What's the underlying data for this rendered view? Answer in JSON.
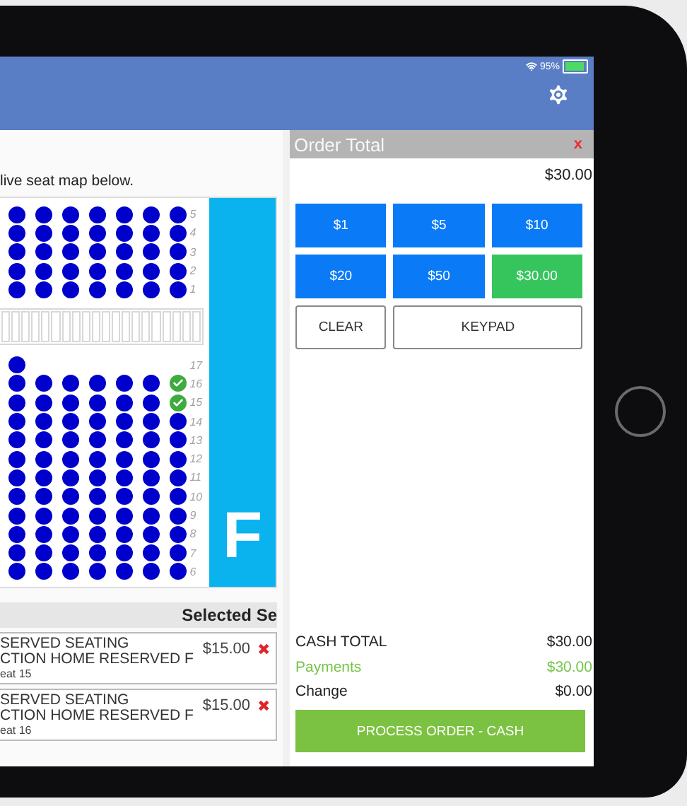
{
  "status_bar": {
    "battery": "95%"
  },
  "intro": "live seat map below.",
  "seat_map": {
    "section_label": "F",
    "upper_rows": [
      {
        "label": "5",
        "seats": [
          {
            "selected": false
          },
          {
            "selected": false
          },
          {
            "selected": false
          },
          {
            "selected": false
          },
          {
            "selected": false
          },
          {
            "selected": false
          },
          {
            "selected": false
          }
        ]
      },
      {
        "label": "4",
        "seats": [
          {
            "selected": false
          },
          {
            "selected": false
          },
          {
            "selected": false
          },
          {
            "selected": false
          },
          {
            "selected": false
          },
          {
            "selected": false
          },
          {
            "selected": false
          }
        ]
      },
      {
        "label": "3",
        "seats": [
          {
            "selected": false
          },
          {
            "selected": false
          },
          {
            "selected": false
          },
          {
            "selected": false
          },
          {
            "selected": false
          },
          {
            "selected": false
          },
          {
            "selected": false
          }
        ]
      },
      {
        "label": "2",
        "seats": [
          {
            "selected": false
          },
          {
            "selected": false
          },
          {
            "selected": false
          },
          {
            "selected": false
          },
          {
            "selected": false
          },
          {
            "selected": false
          },
          {
            "selected": false
          }
        ]
      },
      {
        "label": "1",
        "seats": [
          {
            "selected": false
          },
          {
            "selected": false
          },
          {
            "selected": false
          },
          {
            "selected": false
          },
          {
            "selected": false
          },
          {
            "selected": false
          },
          {
            "selected": false
          }
        ]
      }
    ],
    "lower_rows": [
      {
        "label": "17",
        "seats": [
          {
            "selected": false
          }
        ]
      },
      {
        "label": "16",
        "seats": [
          {
            "selected": false
          },
          {
            "selected": false
          },
          {
            "selected": false
          },
          {
            "selected": false
          },
          {
            "selected": false
          },
          {
            "selected": false
          },
          {
            "selected": true
          }
        ]
      },
      {
        "label": "15",
        "seats": [
          {
            "selected": false
          },
          {
            "selected": false
          },
          {
            "selected": false
          },
          {
            "selected": false
          },
          {
            "selected": false
          },
          {
            "selected": false
          },
          {
            "selected": true
          }
        ]
      },
      {
        "label": "14",
        "seats": [
          {
            "selected": false
          },
          {
            "selected": false
          },
          {
            "selected": false
          },
          {
            "selected": false
          },
          {
            "selected": false
          },
          {
            "selected": false
          },
          {
            "selected": false
          }
        ]
      },
      {
        "label": "13",
        "seats": [
          {
            "selected": false
          },
          {
            "selected": false
          },
          {
            "selected": false
          },
          {
            "selected": false
          },
          {
            "selected": false
          },
          {
            "selected": false
          },
          {
            "selected": false
          }
        ]
      },
      {
        "label": "12",
        "seats": [
          {
            "selected": false
          },
          {
            "selected": false
          },
          {
            "selected": false
          },
          {
            "selected": false
          },
          {
            "selected": false
          },
          {
            "selected": false
          },
          {
            "selected": false
          }
        ]
      },
      {
        "label": "11",
        "seats": [
          {
            "selected": false
          },
          {
            "selected": false
          },
          {
            "selected": false
          },
          {
            "selected": false
          },
          {
            "selected": false
          },
          {
            "selected": false
          },
          {
            "selected": false
          }
        ]
      },
      {
        "label": "10",
        "seats": [
          {
            "selected": false
          },
          {
            "selected": false
          },
          {
            "selected": false
          },
          {
            "selected": false
          },
          {
            "selected": false
          },
          {
            "selected": false
          },
          {
            "selected": false
          }
        ]
      },
      {
        "label": "9",
        "seats": [
          {
            "selected": false
          },
          {
            "selected": false
          },
          {
            "selected": false
          },
          {
            "selected": false
          },
          {
            "selected": false
          },
          {
            "selected": false
          },
          {
            "selected": false
          }
        ]
      },
      {
        "label": "8",
        "seats": [
          {
            "selected": false
          },
          {
            "selected": false
          },
          {
            "selected": false
          },
          {
            "selected": false
          },
          {
            "selected": false
          },
          {
            "selected": false
          },
          {
            "selected": false
          }
        ]
      },
      {
        "label": "7",
        "seats": [
          {
            "selected": false
          },
          {
            "selected": false
          },
          {
            "selected": false
          },
          {
            "selected": false
          },
          {
            "selected": false
          },
          {
            "selected": false
          },
          {
            "selected": false
          }
        ]
      },
      {
        "label": "6",
        "seats": [
          {
            "selected": false
          },
          {
            "selected": false
          },
          {
            "selected": false
          },
          {
            "selected": false
          },
          {
            "selected": false
          },
          {
            "selected": false
          },
          {
            "selected": false
          }
        ]
      }
    ]
  },
  "selected_seats": {
    "heading": "Selected Se",
    "items": [
      {
        "line_1": "SERVED SEATING",
        "line_2": "CTION HOME RESERVED F",
        "line_3": "eat 15",
        "price": "$15.00",
        "remove": "✖"
      },
      {
        "line_1": "SERVED SEATING",
        "line_2": "CTION HOME RESERVED F",
        "line_3": "eat 16",
        "price": "$15.00",
        "remove": "✖"
      }
    ]
  },
  "order": {
    "title": "Order Total",
    "close": "x",
    "amount": "$30.00",
    "quick_buttons": [
      {
        "label": "$1",
        "selected": false
      },
      {
        "label": "$5",
        "selected": false
      },
      {
        "label": "$10",
        "selected": false
      },
      {
        "label": "$20",
        "selected": false
      },
      {
        "label": "$50",
        "selected": false
      },
      {
        "label": "$30.00",
        "selected": true
      }
    ],
    "clear": "CLEAR",
    "keypad": "KEYPAD",
    "totals": [
      {
        "label": "CASH TOTAL",
        "value": "$30.00",
        "kind": "plain"
      },
      {
        "label": "Payments",
        "value": "$30.00",
        "kind": "paid"
      },
      {
        "label": "Change",
        "value": "$0.00",
        "kind": "plain"
      }
    ],
    "process": "PROCESS ORDER - CASH"
  }
}
